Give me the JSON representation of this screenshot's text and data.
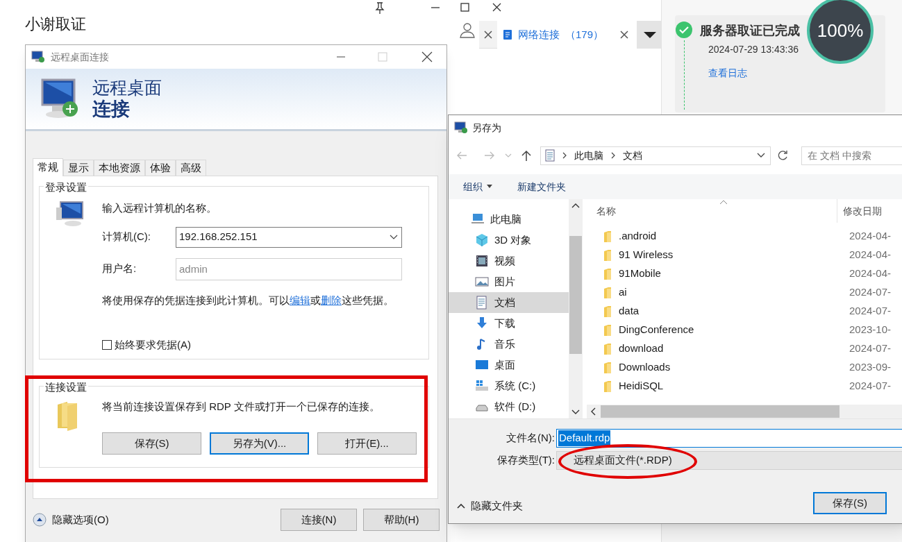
{
  "app": {
    "title": "小谢取证",
    "tabs": [
      {
        "label": "网络连接",
        "count": "（179）",
        "selected": true
      }
    ],
    "task": {
      "title": "服务器取证已完成",
      "time": "2024-07-29 13:43:36",
      "link": "查看日志",
      "progress": "100%",
      "done": true
    }
  },
  "rdp": {
    "title": "远程桌面连接",
    "banner_line1": "远程桌面",
    "banner_line2": "连接",
    "tabs": [
      {
        "label": "常规",
        "selected": true
      },
      {
        "label": "显示",
        "selected": false
      },
      {
        "label": "本地资源",
        "selected": false
      },
      {
        "label": "体验",
        "selected": false
      },
      {
        "label": "高级",
        "selected": false
      }
    ],
    "login_group": "登录设置",
    "prompt": "输入远程计算机的名称。",
    "computer_label": "计算机(C):",
    "computer_value": "192.168.252.151",
    "user_label": "用户名:",
    "user_placeholder": "admin",
    "note_parts": [
      {
        "kind": "text",
        "text": "将使用保存的凭据连接到此计算机。可以"
      },
      {
        "kind": "link",
        "text": "编辑"
      },
      {
        "kind": "text",
        "text": "或"
      },
      {
        "kind": "link",
        "text": "删除"
      },
      {
        "kind": "text",
        "text": "这些凭据。"
      }
    ],
    "always_ask": {
      "label": "始终要求凭据(A)",
      "checked": false
    },
    "connection_group": "连接设置",
    "connection_note": "将当前连接设置保存到 RDP 文件或打开一个已保存的连接。",
    "buttons": [
      {
        "label": "保存(S)",
        "focused": false
      },
      {
        "label": "另存为(V)...",
        "focused": true
      },
      {
        "label": "打开(E)...",
        "focused": false
      }
    ],
    "options_toggle": "隐藏选项(O)",
    "footer_buttons": [
      "连接(N)",
      "帮助(H)"
    ]
  },
  "save_as": {
    "title": "另存为",
    "breadcrumb": [
      "此电脑",
      "文档"
    ],
    "search_placeholder": "在 文档 中搜索",
    "organize": "组织",
    "new_folder": "新建文件夹",
    "nav": [
      {
        "label": "此电脑",
        "kind": "pc",
        "selected": false
      },
      {
        "label": "3D 对象",
        "kind": "cube",
        "selected": false
      },
      {
        "label": "视频",
        "kind": "video",
        "selected": false
      },
      {
        "label": "图片",
        "kind": "image",
        "selected": false
      },
      {
        "label": "文档",
        "kind": "doc",
        "selected": true
      },
      {
        "label": "下载",
        "kind": "download",
        "selected": false
      },
      {
        "label": "音乐",
        "kind": "music",
        "selected": false
      },
      {
        "label": "桌面",
        "kind": "desktop",
        "selected": false
      },
      {
        "label": "系统 (C:)",
        "kind": "sysdrive",
        "selected": false
      },
      {
        "label": "软件 (D:)",
        "kind": "drive",
        "selected": false
      }
    ],
    "columns": [
      "名称",
      "修改日期"
    ],
    "rows": [
      {
        "name": ".android",
        "date": "2024-04-"
      },
      {
        "name": "91 Wireless",
        "date": "2024-04-"
      },
      {
        "name": "91Mobile",
        "date": "2024-04-"
      },
      {
        "name": "ai",
        "date": "2024-07-"
      },
      {
        "name": "data",
        "date": "2024-07-"
      },
      {
        "name": "DingConference",
        "date": "2023-10-"
      },
      {
        "name": "download",
        "date": "2024-07-"
      },
      {
        "name": "Downloads",
        "date": "2023-09-"
      },
      {
        "name": "HeidiSQL",
        "date": "2024-07-"
      }
    ],
    "filename_label": "文件名(N):",
    "filename_value": "Default.rdp",
    "type_label": "保存类型(T):",
    "type_value": "远程桌面文件(*.RDP)",
    "hide_folders": "隐藏文件夹",
    "save_button": "保存(S)"
  }
}
